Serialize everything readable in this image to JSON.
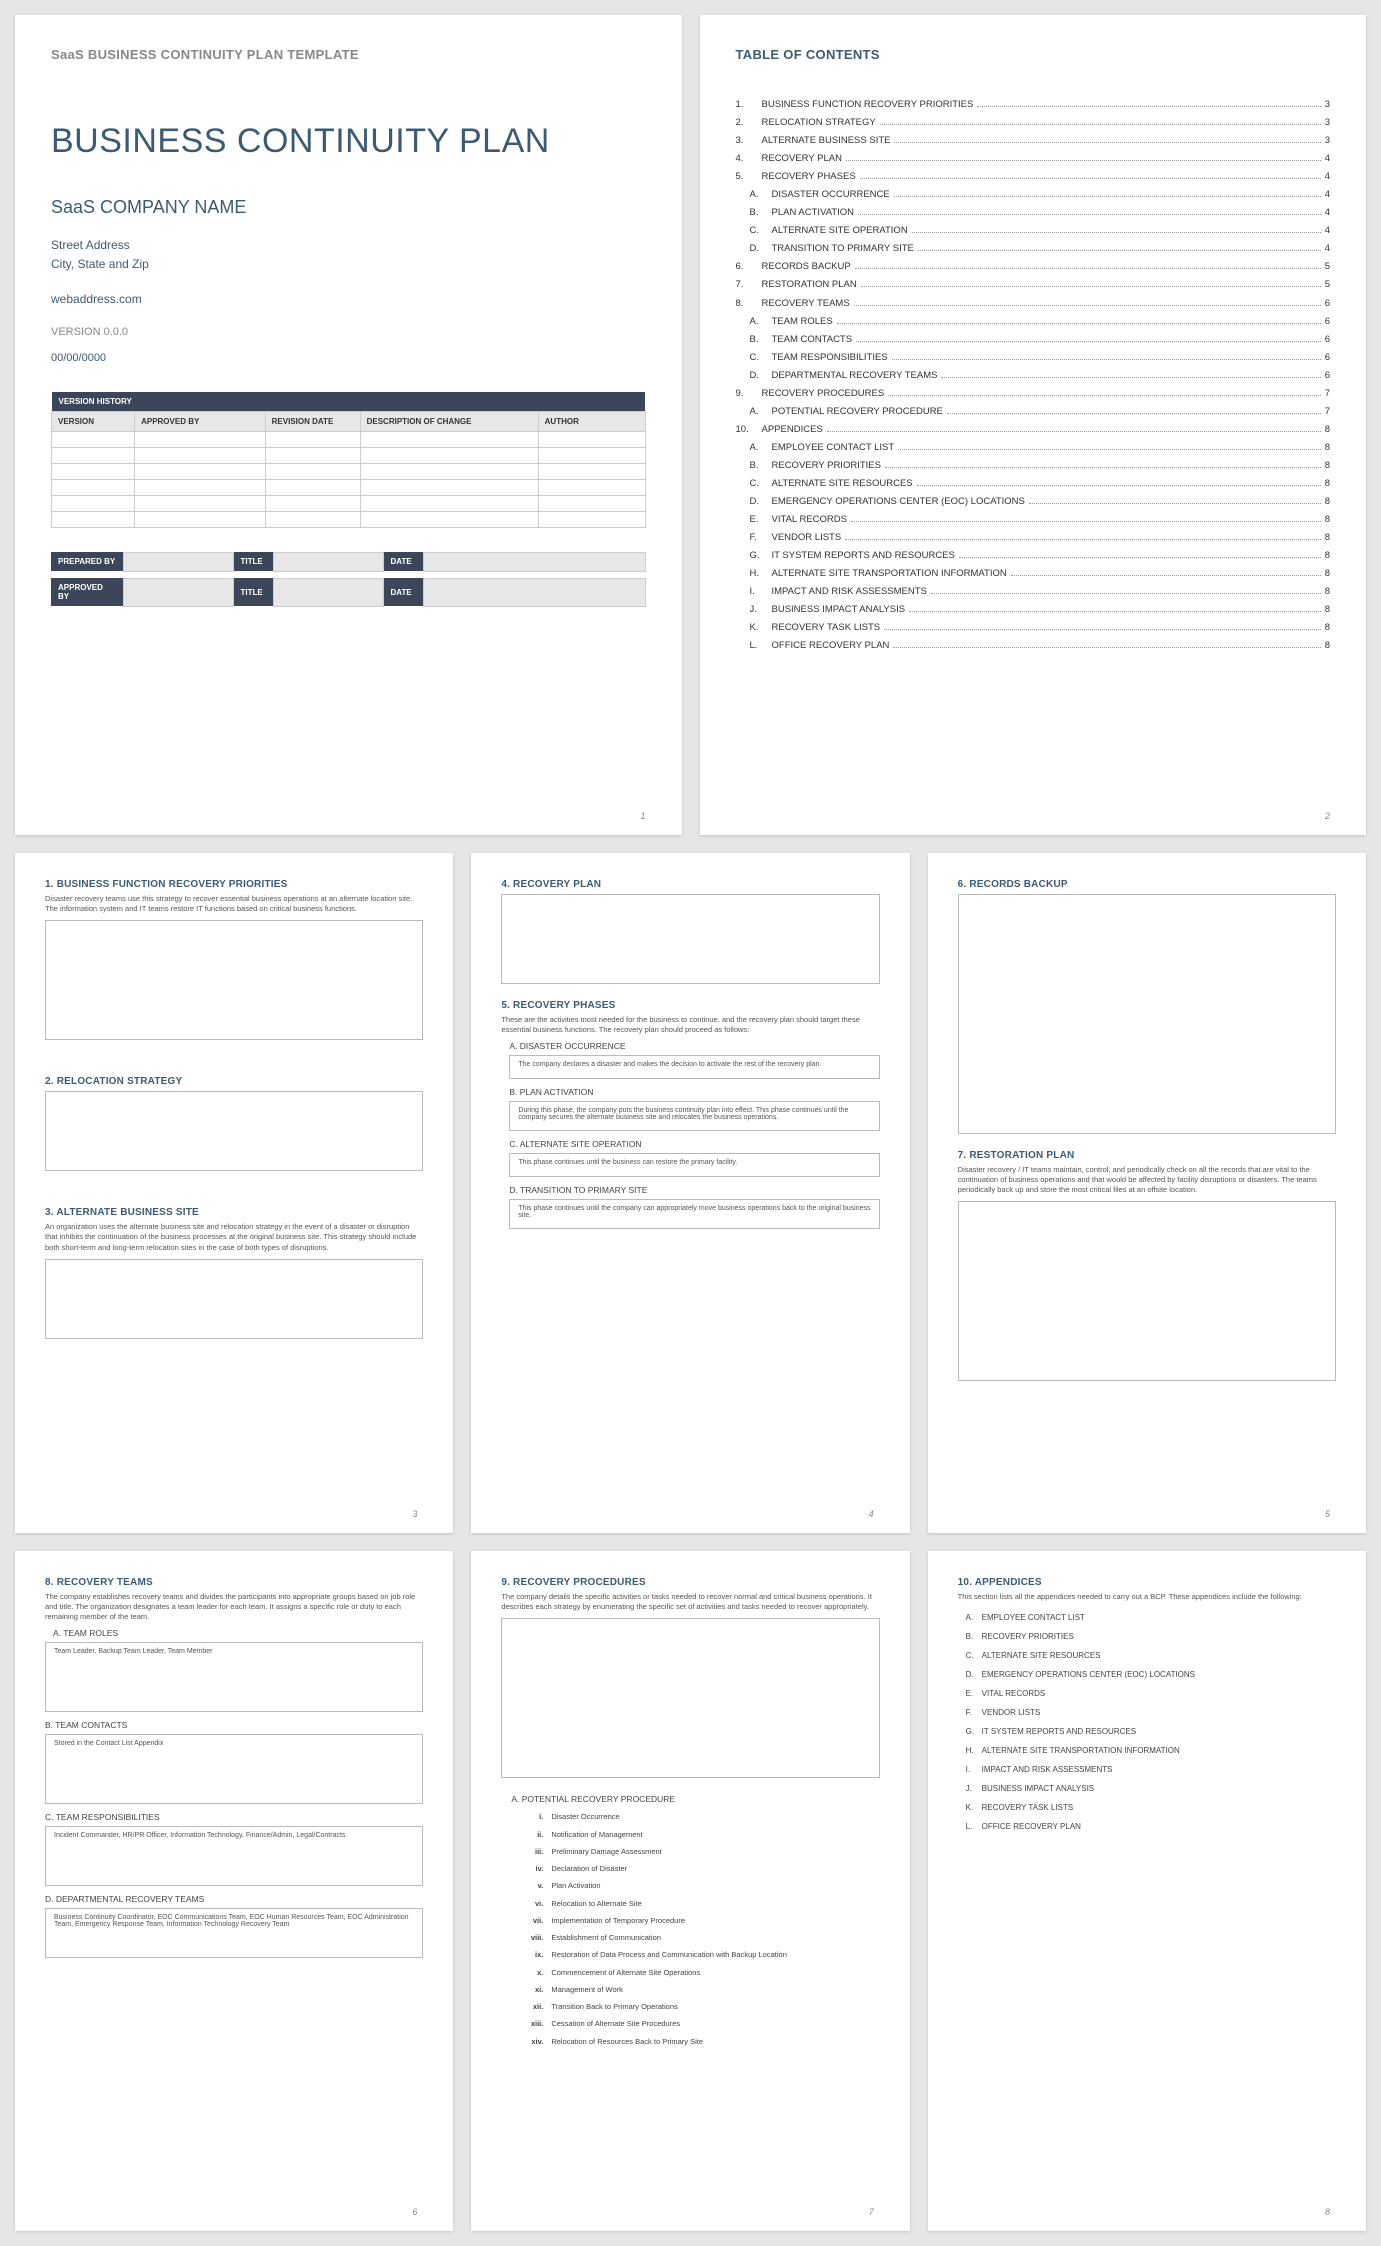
{
  "cover": {
    "template_header": "SaaS BUSINESS CONTINUITY PLAN TEMPLATE",
    "title": "BUSINESS CONTINUITY PLAN",
    "company": "SaaS COMPANY NAME",
    "street": "Street Address",
    "city": "City, State and Zip",
    "web": "webaddress.com",
    "version": "VERSION 0.0.0",
    "date": "00/00/0000",
    "vh_header": "VERSION HISTORY",
    "vh_cols": [
      "VERSION",
      "APPROVED BY",
      "REVISION DATE",
      "DESCRIPTION OF CHANGE",
      "AUTHOR"
    ],
    "sign": {
      "prepared": "PREPARED BY",
      "approved": "APPROVED BY",
      "title": "TITLE",
      "date": "DATE"
    },
    "page_num": "1"
  },
  "toc": {
    "title": "TABLE OF CONTENTS",
    "items": [
      {
        "n": "1.",
        "l": "BUSINESS FUNCTION RECOVERY PRIORITIES",
        "p": "3"
      },
      {
        "n": "2.",
        "l": "RELOCATION STRATEGY",
        "p": "3"
      },
      {
        "n": "3.",
        "l": "ALTERNATE BUSINESS SITE",
        "p": "3"
      },
      {
        "n": "4.",
        "l": "RECOVERY PLAN",
        "p": "4"
      },
      {
        "n": "5.",
        "l": "RECOVERY PHASES",
        "p": "4"
      },
      {
        "n": "A.",
        "l": "DISASTER OCCURRENCE",
        "p": "4",
        "sub": true
      },
      {
        "n": "B.",
        "l": "PLAN ACTIVATION",
        "p": "4",
        "sub": true
      },
      {
        "n": "C.",
        "l": "ALTERNATE SITE OPERATION",
        "p": "4",
        "sub": true
      },
      {
        "n": "D.",
        "l": "TRANSITION TO PRIMARY SITE",
        "p": "4",
        "sub": true
      },
      {
        "n": "6.",
        "l": "RECORDS BACKUP",
        "p": "5"
      },
      {
        "n": "7.",
        "l": "RESTORATION PLAN",
        "p": "5"
      },
      {
        "n": "8.",
        "l": "RECOVERY TEAMS",
        "p": "6"
      },
      {
        "n": "A.",
        "l": "TEAM ROLES",
        "p": "6",
        "sub": true
      },
      {
        "n": "B.",
        "l": "TEAM CONTACTS",
        "p": "6",
        "sub": true
      },
      {
        "n": "C.",
        "l": "TEAM RESPONSIBILITIES",
        "p": "6",
        "sub": true
      },
      {
        "n": "D.",
        "l": "DEPARTMENTAL RECOVERY TEAMS",
        "p": "6",
        "sub": true
      },
      {
        "n": "9.",
        "l": "RECOVERY PROCEDURES",
        "p": "7"
      },
      {
        "n": "A.",
        "l": "POTENTIAL RECOVERY PROCEDURE",
        "p": "7",
        "sub": true
      },
      {
        "n": "10.",
        "l": "APPENDICES",
        "p": "8"
      },
      {
        "n": "A.",
        "l": "EMPLOYEE CONTACT LIST",
        "p": "8",
        "sub": true
      },
      {
        "n": "B.",
        "l": "RECOVERY PRIORITIES",
        "p": "8",
        "sub": true
      },
      {
        "n": "C.",
        "l": "ALTERNATE SITE RESOURCES",
        "p": "8",
        "sub": true
      },
      {
        "n": "D.",
        "l": "EMERGENCY OPERATIONS CENTER (EOC) LOCATIONS",
        "p": "8",
        "sub": true
      },
      {
        "n": "E.",
        "l": "VITAL RECORDS",
        "p": "8",
        "sub": true
      },
      {
        "n": "F.",
        "l": "VENDOR LISTS",
        "p": "8",
        "sub": true
      },
      {
        "n": "G.",
        "l": "IT SYSTEM REPORTS AND RESOURCES",
        "p": "8",
        "sub": true
      },
      {
        "n": "H.",
        "l": "ALTERNATE SITE TRANSPORTATION INFORMATION",
        "p": "8",
        "sub": true
      },
      {
        "n": "I.",
        "l": "IMPACT AND RISK ASSESSMENTS",
        "p": "8",
        "sub": true
      },
      {
        "n": "J.",
        "l": "BUSINESS IMPACT ANALYSIS",
        "p": "8",
        "sub": true
      },
      {
        "n": "K.",
        "l": "RECOVERY TASK LISTS",
        "p": "8",
        "sub": true
      },
      {
        "n": "L.",
        "l": "OFFICE RECOVERY PLAN",
        "p": "8",
        "sub": true
      }
    ],
    "page_num": "2"
  },
  "p3": {
    "s1_title": "1. BUSINESS FUNCTION RECOVERY PRIORITIES",
    "s1_desc": "Disaster recovery teams use this strategy to recover essential business operations at an alternate location site. The information system and IT teams restore IT functions based on critical business functions.",
    "s2_title": "2. RELOCATION STRATEGY",
    "s3_title": "3. ALTERNATE BUSINESS SITE",
    "s3_desc": "An organization uses the alternate business site and relocation strategy in the event of a disaster or disruption that inhibits the continuation of the business processes at the original business site. This strategy should include both short-term and long-term relocation sites in the case of both types of disruptions.",
    "page_num": "3"
  },
  "p4": {
    "s4_title": "4. RECOVERY PLAN",
    "s5_title": "5. RECOVERY PHASES",
    "s5_desc": "These are the activities most needed for the business to continue, and the recovery plan should target these essential business functions. The recovery plan should proceed as follows:",
    "a_title": "A. DISASTER OCCURRENCE",
    "a_text": "The company declares a disaster and makes the decision to activate the rest of the recovery plan.",
    "b_title": "B. PLAN ACTIVATION",
    "b_text": "During this phase, the company puts the business continuity plan into effect. This phase continues until the company secures the alternate business site and relocates the business operations.",
    "c_title": "C. ALTERNATE SITE OPERATION",
    "c_text": "This phase continues until the business can restore the primary facility.",
    "d_title": "D. TRANSITION TO PRIMARY SITE",
    "d_text": "This phase continues until the company can appropriately move business operations back to the original business site.",
    "page_num": "4"
  },
  "p5": {
    "s6_title": "6. RECORDS BACKUP",
    "s7_title": "7. RESTORATION PLAN",
    "s7_desc": "Disaster recovery / IT teams maintain, control, and periodically check on all the records that are vital to the continuation of business operations and that would be affected by facility disruptions or disasters. The teams periodically back up and store the most critical files at an offsite location.",
    "page_num": "5"
  },
  "p6": {
    "s8_title": "8. RECOVERY TEAMS",
    "s8_desc": "The company establishes recovery teams and divides the participants into appropriate groups based on job role and title. The organization designates a team leader for each team. It assigns a specific role or duty to each remaining member of the team.",
    "a_title": "A. TEAM ROLES",
    "a_text": "Team Leader, Backup Team Leader, Team Member",
    "b_title": "B. TEAM CONTACTS",
    "b_text": "Stored in the Contact List Appendix",
    "c_title": "C. TEAM RESPONSIBILITIES",
    "c_text": "Incident Commander, HR/PR Officer, Information Technology, Finance/Admin, Legal/Contracts",
    "d_title": "D. DEPARTMENTAL RECOVERY TEAMS",
    "d_text": "Business Continuity Coordinator, EOC Communications Team, EOC Human Resources Team, EOC Administration Team, Emergency Response Team, Information Technology Recovery Team",
    "page_num": "6"
  },
  "p7": {
    "s9_title": "9. RECOVERY PROCEDURES",
    "s9_desc": "The company details the specific activities or tasks needed to recover normal and critical business operations. It describes each strategy by enumerating the specific set of activities and tasks needed to recover appropriately.",
    "a_title": "A. POTENTIAL RECOVERY PROCEDURE",
    "steps": [
      {
        "rn": "i.",
        "t": "Disaster Occurrence"
      },
      {
        "rn": "ii.",
        "t": "Notification of Management"
      },
      {
        "rn": "iii.",
        "t": "Preliminary Damage Assessment"
      },
      {
        "rn": "iv.",
        "t": "Declaration of Disaster"
      },
      {
        "rn": "v.",
        "t": "Plan Activation"
      },
      {
        "rn": "vi.",
        "t": "Relocation to Alternate Site"
      },
      {
        "rn": "vii.",
        "t": "Implementation of Temporary Procedure"
      },
      {
        "rn": "viii.",
        "t": "Establishment of Communication"
      },
      {
        "rn": "ix.",
        "t": "Restoration of Data Process and Communication with Backup Location"
      },
      {
        "rn": "x.",
        "t": "Commencement of Alternate Site Operations"
      },
      {
        "rn": "xi.",
        "t": "Management of Work"
      },
      {
        "rn": "xii.",
        "t": "Transition Back to Primary Operations"
      },
      {
        "rn": "xiii.",
        "t": "Cessation of Alternate Site Procedures"
      },
      {
        "rn": "xiv.",
        "t": "Relocation of Resources Back to Primary Site"
      }
    ],
    "page_num": "7"
  },
  "p8": {
    "s10_title": "10.   APPENDICES",
    "s10_desc": "This section lists all the appendices needed to carry out a BCP. These appendices include the following:",
    "items": [
      {
        "lt": "A.",
        "t": "EMPLOYEE CONTACT LIST"
      },
      {
        "lt": "B.",
        "t": "RECOVERY PRIORITIES"
      },
      {
        "lt": "C.",
        "t": "ALTERNATE SITE RESOURCES"
      },
      {
        "lt": "D.",
        "t": "EMERGENCY OPERATIONS CENTER (EOC) LOCATIONS"
      },
      {
        "lt": "E.",
        "t": "VITAL RECORDS"
      },
      {
        "lt": "F.",
        "t": "VENDOR LISTS"
      },
      {
        "lt": "G.",
        "t": "IT SYSTEM REPORTS AND RESOURCES"
      },
      {
        "lt": "H.",
        "t": "ALTERNATE SITE TRANSPORTATION INFORMATION"
      },
      {
        "lt": "I.",
        "t": "IMPACT AND RISK ASSESSMENTS"
      },
      {
        "lt": "J.",
        "t": "BUSINESS IMPACT ANALYSIS"
      },
      {
        "lt": "K.",
        "t": "RECOVERY TASK LISTS"
      },
      {
        "lt": "L.",
        "t": "OFFICE RECOVERY PLAN"
      }
    ],
    "page_num": "8"
  }
}
